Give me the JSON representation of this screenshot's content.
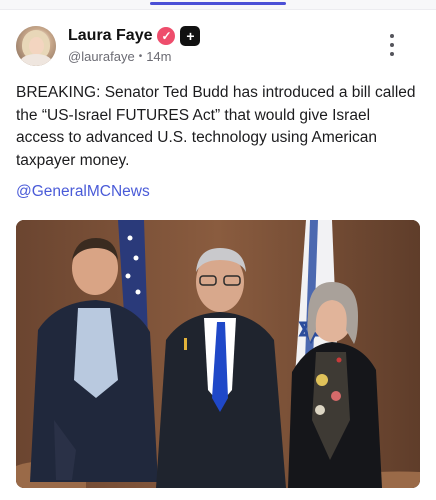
{
  "post": {
    "author_name": "Laura Faye",
    "verified_icon": "verified-check-icon",
    "plus_badge_icon": "plus-badge-icon",
    "handle": "@laurafaye",
    "separator": "•",
    "time": "14m",
    "text": "BREAKING: Senator Ted Budd has introduced a bill called the “US-Israel FUTURES Act” that would give Israel access to advanced U.S. technology using American taxpayer money.",
    "mention": "@GeneralMCNews",
    "colors": {
      "accent": "#4a5bd8",
      "verified": "#ee4d6c",
      "tab_indicator": "#4a4fd6"
    }
  }
}
